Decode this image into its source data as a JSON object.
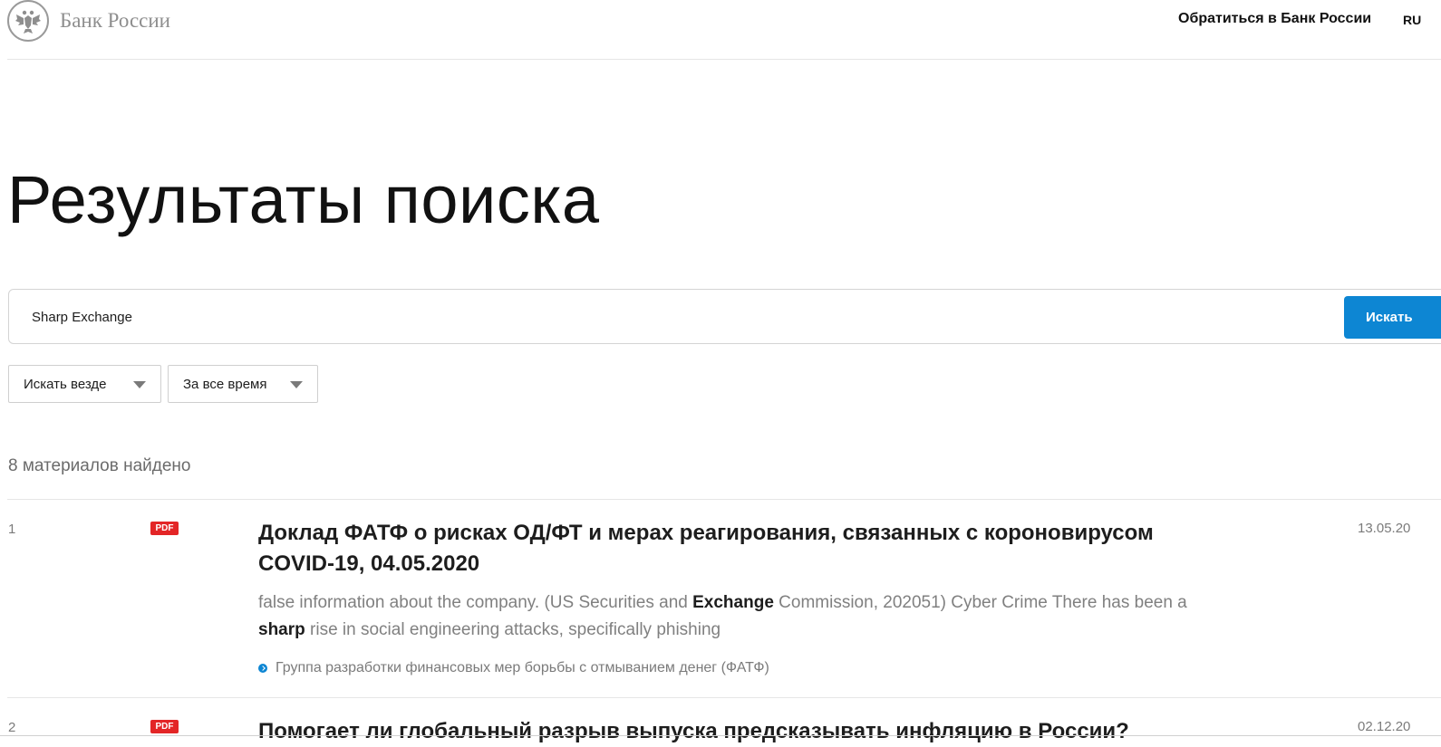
{
  "header": {
    "logo_text": "Банк России",
    "contact_link": "Обратиться в Банк России",
    "language": "RU"
  },
  "page_title": "Результаты поиска",
  "search": {
    "value": "Sharp Exchange",
    "button_label": "Искать"
  },
  "filters": {
    "scope": "Искать везде",
    "period": "За все время"
  },
  "results_count": "8 материалов найдено",
  "results": [
    {
      "number": "1",
      "badge": "PDF",
      "title": "Доклад ФАТФ о рисках ОД/ФТ и мерах реагирования, связанных с короновирусом COVID-19, 04.05.2020",
      "snippet_parts": [
        "false information about the company. (US Securities and ",
        "Exchange",
        " Commission, 202051) Cyber Crime There has been a ",
        "sharp",
        " rise in social engineering attacks, specifically phishing"
      ],
      "source": "Группа разработки финансовых мер борьбы с отмыванием денег (ФАТФ)",
      "date": "13.05.20"
    },
    {
      "number": "2",
      "badge": "PDF",
      "title": "Помогает ли глобальный разрыв выпуска предсказывать инфляцию в России?",
      "date": "02.12.20"
    }
  ],
  "colors": {
    "accent": "#0d86d3",
    "pdf_badge": "#e32526"
  }
}
